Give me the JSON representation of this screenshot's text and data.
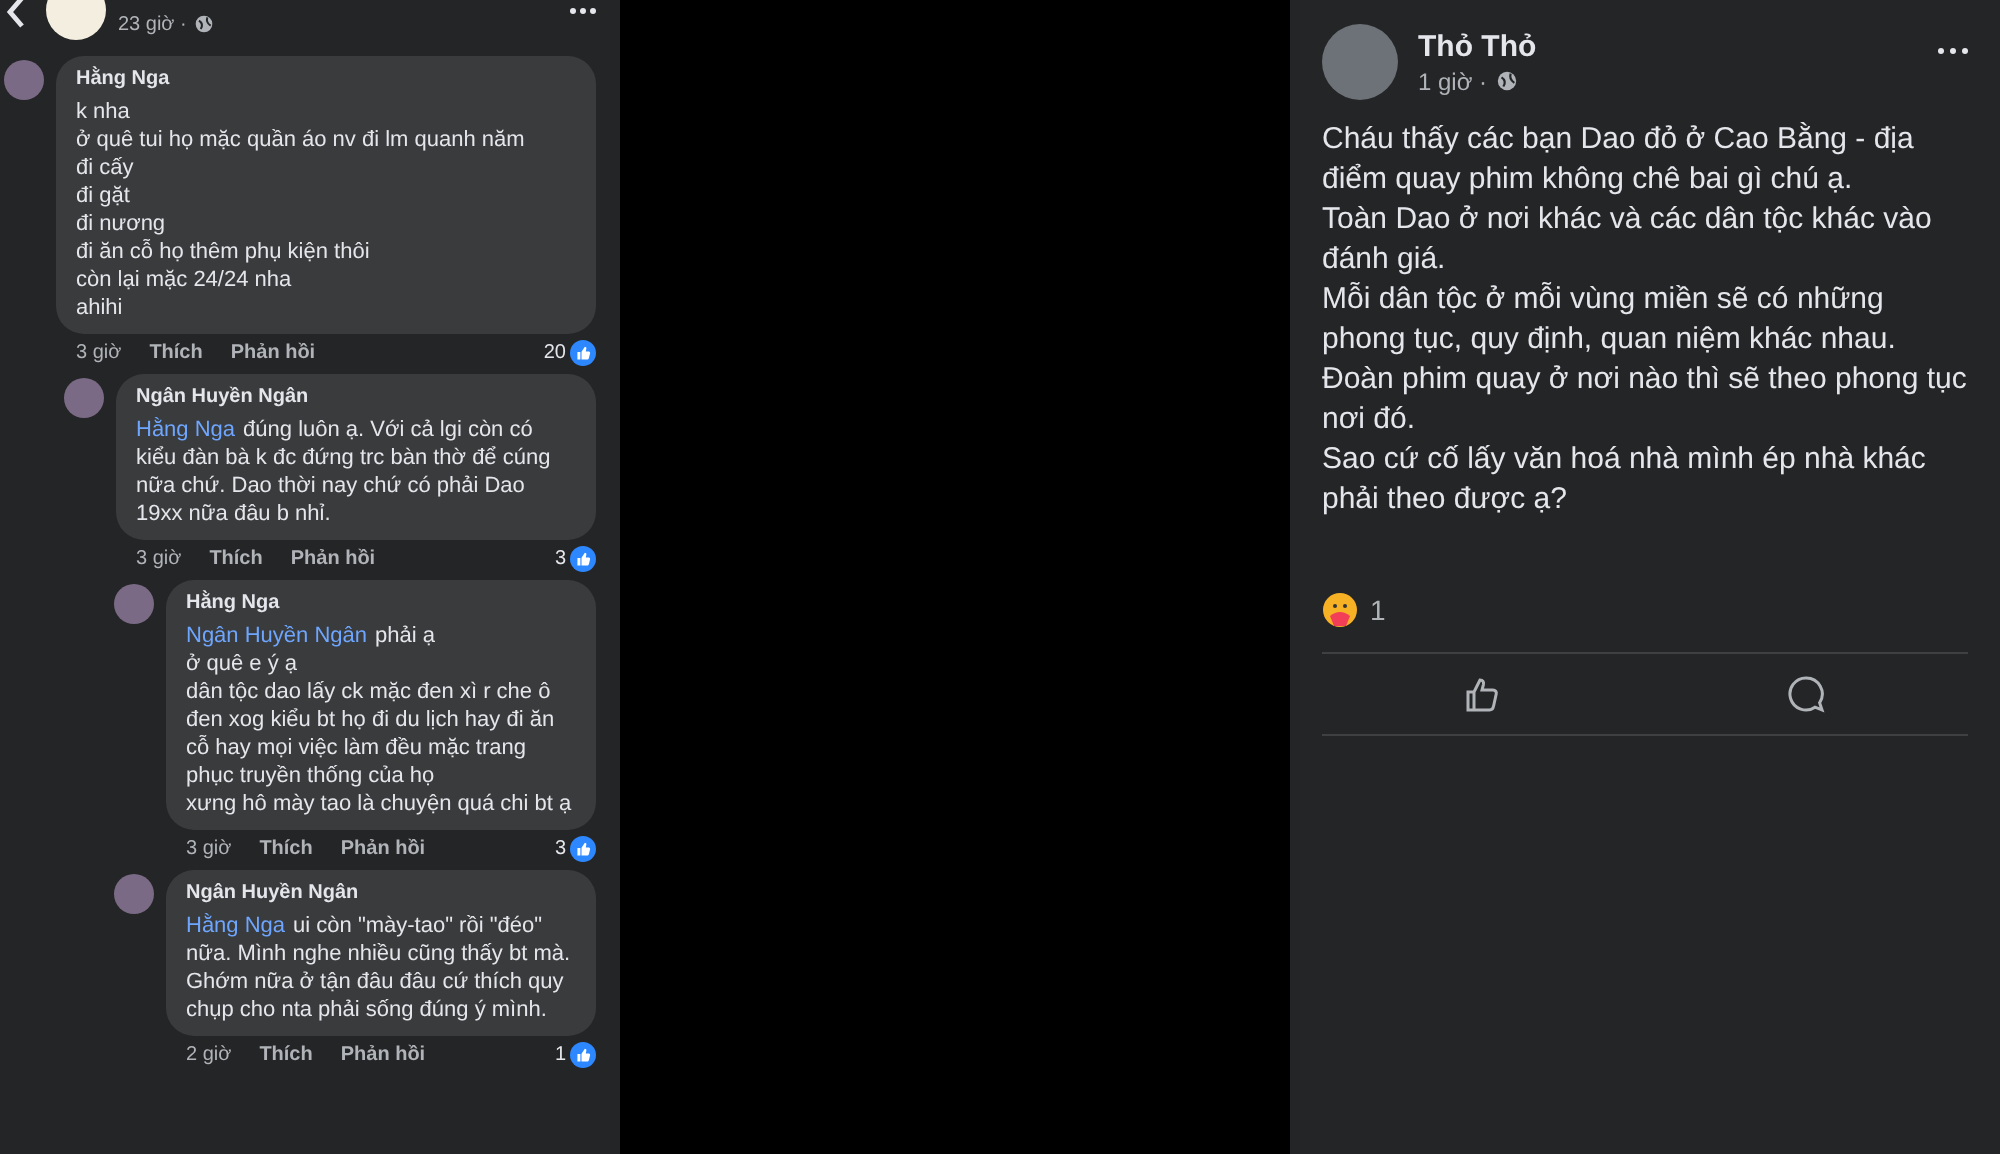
{
  "left_post": {
    "time": "23 giờ ·"
  },
  "comments": [
    {
      "author": "Hằng Nga",
      "paragraphs": [
        "k nha",
        "ở quê tui họ mặc quần áo nv đi lm quanh năm",
        "đi cấy",
        "đi gặt",
        "đi nương",
        "đi ăn cỗ họ thêm phụ kiện thôi",
        "còn lại mặc 24/24 nha",
        "ahihi"
      ],
      "time": "3 giờ",
      "like": "Thích",
      "reply": "Phản hồi",
      "reactions": "20",
      "children": [
        {
          "author": "Ngân Huyền Ngân",
          "mention": "Hằng Nga",
          "paragraphs": [
            "đúng luôn ạ. Với cả lgi còn có kiểu đàn bà k đc đứng trc bàn thờ để cúng nữa chứ. Dao thời nay chứ có phải Dao 19xx nữa đâu b nhỉ."
          ],
          "time": "3 giờ",
          "like": "Thích",
          "reply": "Phản hồi",
          "reactions": "3",
          "children": [
            {
              "author": "Hằng Nga",
              "mention": "Ngân Huyền Ngân",
              "paragraphs": [
                "phải ạ",
                "ở quê e ý ạ",
                "dân tộc dao lấy ck mặc đen xì r che ô đen xog kiểu bt họ đi du lịch hay đi ăn cỗ hay mọi việc làm đều mặc trang phục truyền thống của họ",
                "xưng hô mày tao là chuyện quá chi bt ạ"
              ],
              "time": "3 giờ",
              "like": "Thích",
              "reply": "Phản hồi",
              "reactions": "3"
            },
            {
              "author": "Ngân Huyền Ngân",
              "mention": "Hằng Nga",
              "paragraphs": [
                "ui còn \"mày-tao\" rồi \"đéo\" nữa. Mình nghe nhiều cũng thấy bt mà. Ghớm nữa ở tận đâu đâu cứ thích quy chụp cho nta phải sống đúng ý mình."
              ],
              "time": "2 giờ",
              "like": "Thích",
              "reply": "Phản hồi",
              "reactions": "1"
            }
          ]
        }
      ]
    }
  ],
  "right_post": {
    "author": "Thỏ Thỏ",
    "time": "1 giờ ·",
    "paragraphs": [
      "Cháu thấy các bạn Dao đỏ ở Cao Bằng - địa điểm quay phim không chê bai gì chú ạ.",
      "Toàn Dao ở nơi khác và các dân tộc khác vào đánh giá.",
      "Mỗi dân tộc ở mỗi vùng miền sẽ có những phong tục, quy định, quan niệm khác nhau.",
      "Đoàn phim quay ở nơi nào thì sẽ theo phong tục nơi đó.",
      "Sao cứ cố lấy văn hoá nhà mình ép nhà khác phải theo được ạ?"
    ],
    "reaction_count": "1"
  }
}
